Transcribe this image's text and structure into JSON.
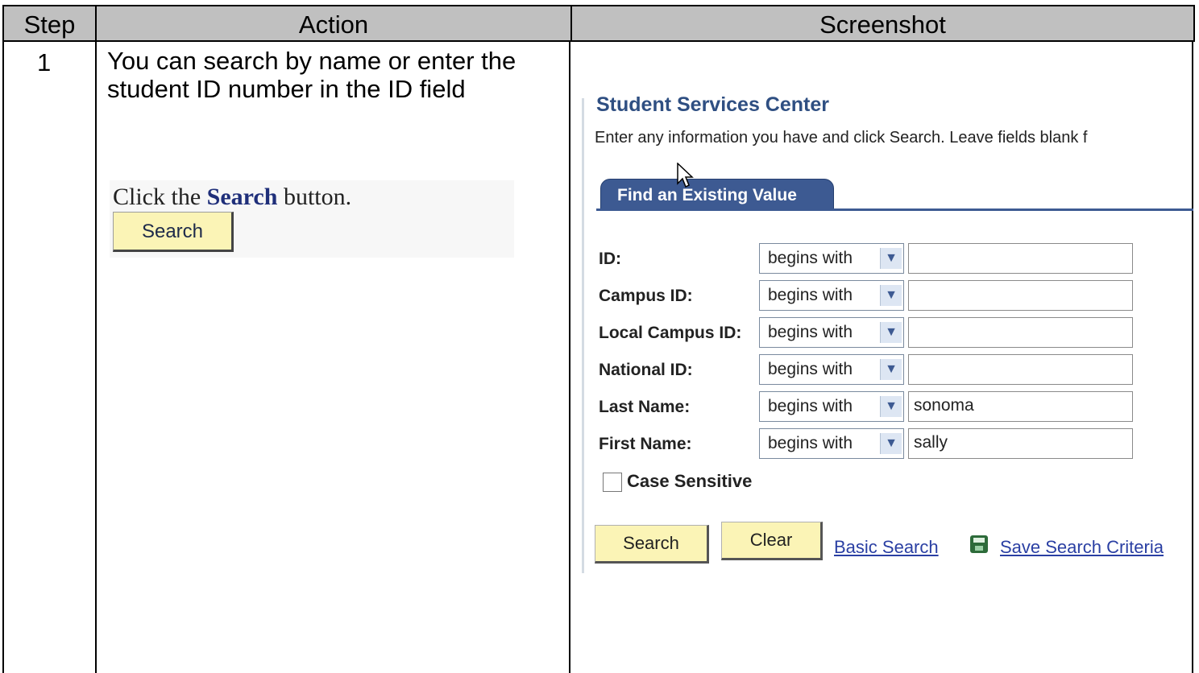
{
  "table": {
    "headers": {
      "step": "Step",
      "action": "Action",
      "screenshot": "Screenshot"
    },
    "row1": {
      "step": "1",
      "action_text": "You can search by name or enter the student ID number in the ID field",
      "instruction_pre": "Click the ",
      "instruction_keyword": "Search",
      "instruction_post": " button.",
      "instruction_button": "Search"
    }
  },
  "screenshot": {
    "title": "Student Services Center",
    "instructions": "Enter any information you have and click Search. Leave fields blank f",
    "tab": "Find an Existing Value",
    "fields": [
      {
        "label": "ID:",
        "operator": "begins with",
        "value": ""
      },
      {
        "label": "Campus ID:",
        "operator": "begins with",
        "value": ""
      },
      {
        "label": "Local Campus ID:",
        "operator": "begins with",
        "value": ""
      },
      {
        "label": "National ID:",
        "operator": "begins with",
        "value": ""
      },
      {
        "label": "Last Name:",
        "operator": "begins with",
        "value": "sonoma"
      },
      {
        "label": "First Name:",
        "operator": "begins with",
        "value": "sally"
      }
    ],
    "case_sensitive_label": "Case Sensitive",
    "search_button": "Search",
    "clear_button": "Clear",
    "basic_search_link": "Basic Search",
    "save_criteria_link": "Save Search Criteria"
  }
}
